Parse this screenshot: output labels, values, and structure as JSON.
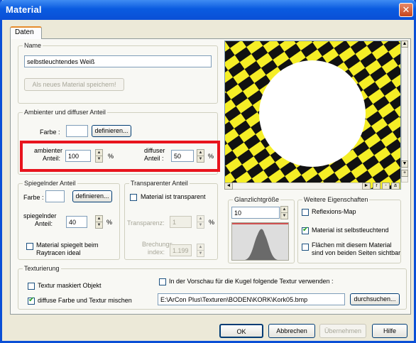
{
  "window": {
    "title": "Material",
    "close_glyph": "✕"
  },
  "tabs": [
    {
      "label": "Daten"
    }
  ],
  "name_group": {
    "legend": "Name",
    "value": "selbstleuchtendes Weiß",
    "save_label": "Als neues Material speichern!"
  },
  "ambient_group": {
    "legend": "Ambienter und diffuser Anteil",
    "color_label": "Farbe :",
    "define_label": "definieren...",
    "ambient_label_1": "ambienter",
    "ambient_label_2": "Anteil:",
    "ambient_value": "100",
    "ambient_unit": "%",
    "diffuse_label_1": "diffuser",
    "diffuse_label_2": "Anteil :",
    "diffuse_value": "50",
    "diffuse_unit": "%"
  },
  "specular_group": {
    "legend": "Spiegelnder Anteil",
    "color_label": "Farbe :",
    "define_label": "definieren...",
    "spec_label_1": "spiegelnder",
    "spec_label_2": "Anteil:",
    "spec_value": "40",
    "spec_unit": "%",
    "raytrace_label_1": "Material spiegelt beim",
    "raytrace_label_2": "Raytracen ideal",
    "raytrace_checked": false
  },
  "transparent_group": {
    "legend": "Transparenter Anteil",
    "is_transparent_label": "Material ist transparent",
    "is_transparent_checked": false,
    "transparency_label": "Transparenz:",
    "transparency_value": "1",
    "transparency_unit": "%",
    "refraction_label_1": "Brechungs-",
    "refraction_label_2": "index:",
    "refraction_value": "1.199"
  },
  "glanz_group": {
    "legend": "Glanzlichtgröße",
    "value": "10"
  },
  "further_group": {
    "legend": "Weitere Eigenschaften",
    "reflexion_label": "Reflexions-Map",
    "reflexion_checked": false,
    "selfillum_label": "Material ist selbstleuchtend",
    "selfillum_checked": true,
    "twosided_label_1": "Flächen mit diesem Material",
    "twosided_label_2": "sind von beiden Seiten sichtbar",
    "twosided_checked": false
  },
  "preview": {
    "btn_plus": "+",
    "btn_minus": "-",
    "btn_r": "r",
    "btn_a": "a",
    "colors": {
      "yellow": "#f5ee26",
      "black": "#111111",
      "sphere": "#ffffff"
    }
  },
  "texture_group": {
    "legend": "Texturierung",
    "mask_label": "Textur maskiert Objekt",
    "mask_checked": false,
    "mix_label": "diffuse Farbe und Textur mischen",
    "mix_checked": true,
    "preview_tex_label": "In der Vorschau für die Kugel folgende Textur verwenden :",
    "preview_tex_checked": false,
    "path": "E:\\ArCon Plus\\Texturen\\BODEN\\KORK\\Kork05.bmp",
    "browse_label": "durchsuchen..."
  },
  "footer": {
    "ok_label": "OK",
    "cancel_label": "Abbrechen",
    "apply_label": "Übernehmen",
    "help_label": "Hilfe"
  },
  "colors": {
    "title_blue": "#0a4fd6",
    "highlight_red": "#e8141d"
  }
}
